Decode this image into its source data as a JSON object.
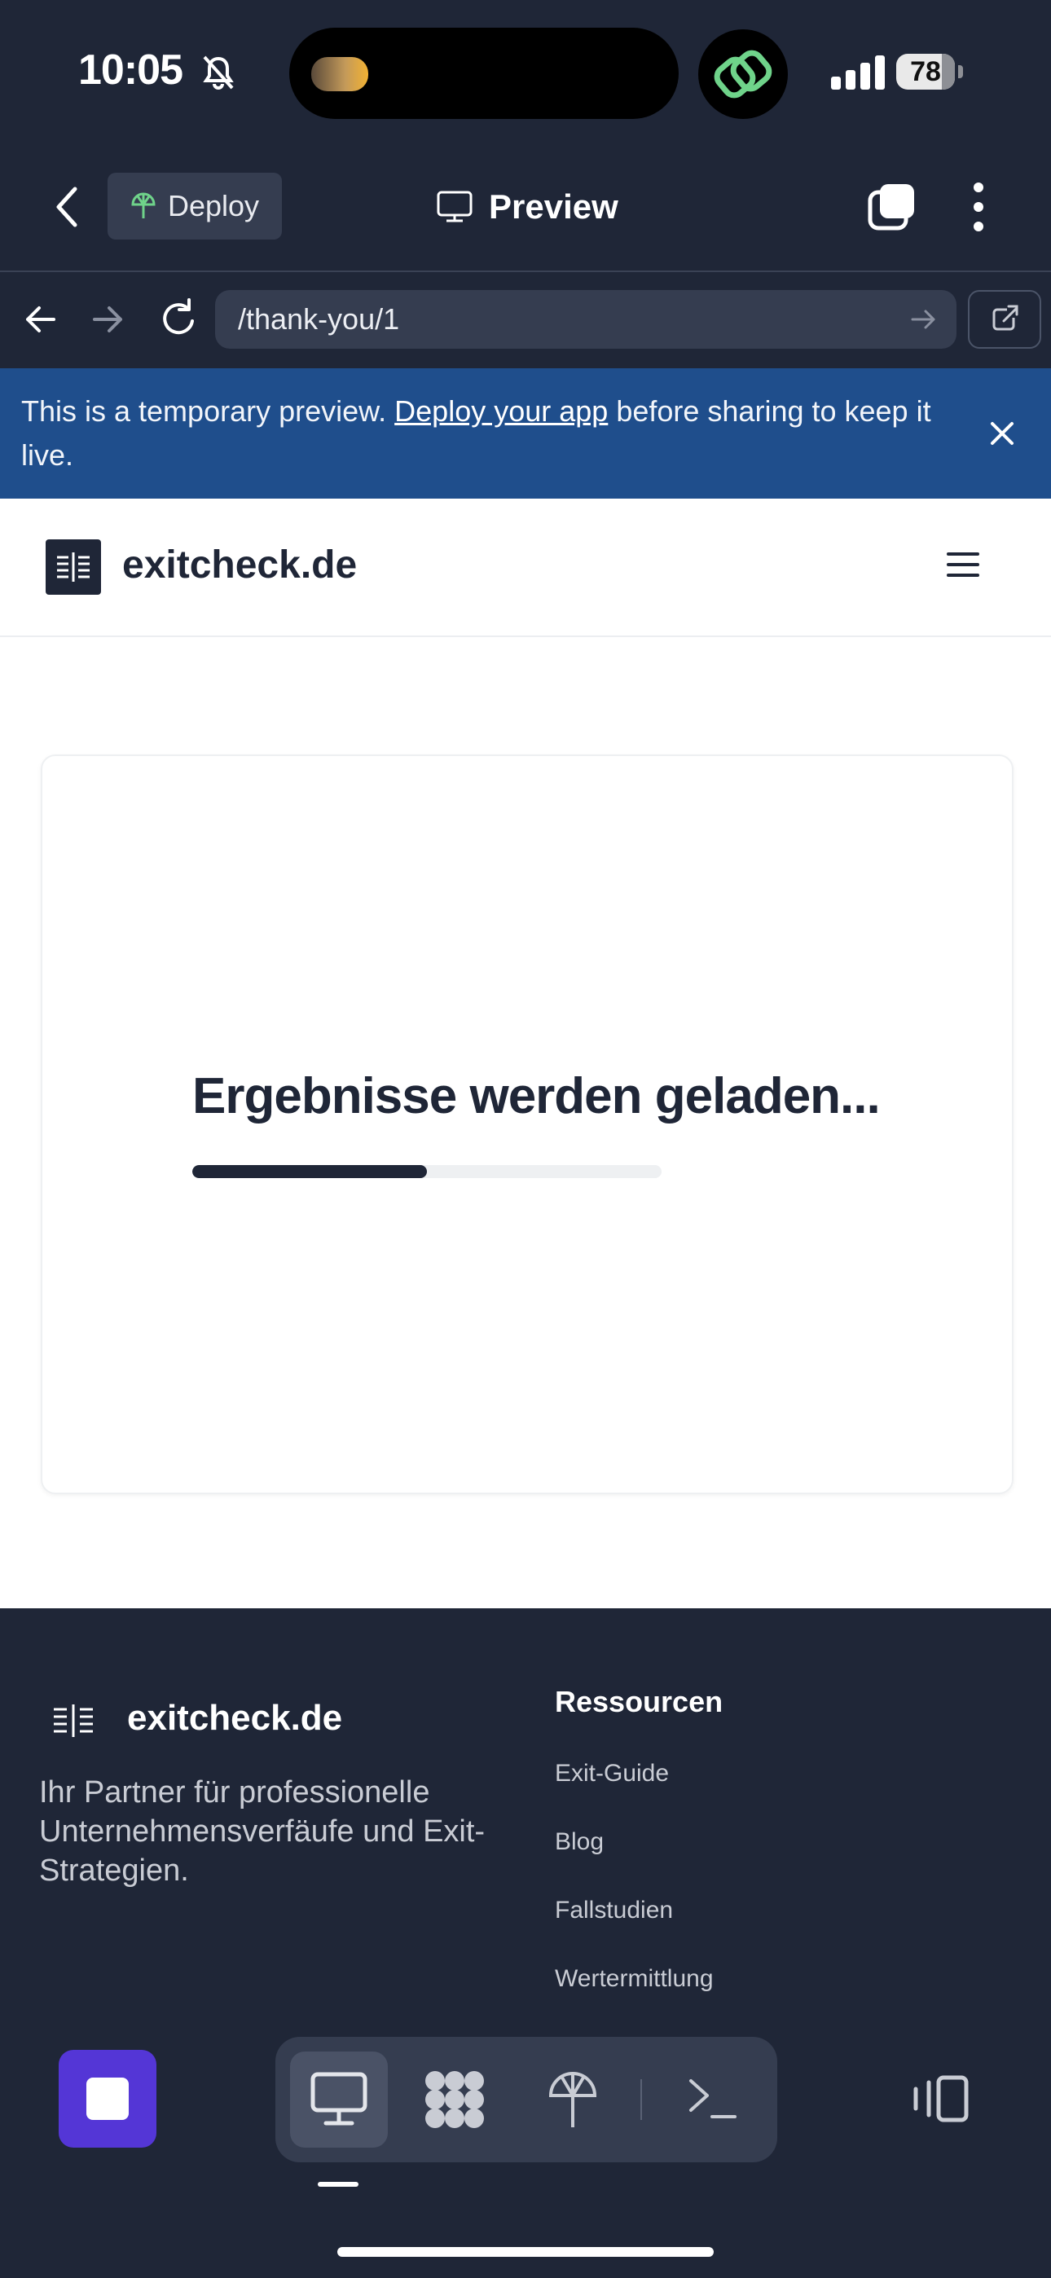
{
  "status_bar": {
    "time": "10:05",
    "battery": "78"
  },
  "toolbar": {
    "deploy_label": "Deploy",
    "title": "Preview"
  },
  "browser": {
    "url": "/thank-you/1"
  },
  "banner": {
    "text_before": "This is a temporary preview. ",
    "link": "Deploy your app",
    "text_after": " before sharing to keep it live."
  },
  "site": {
    "name": "exitcheck.de",
    "loading_title": "Ergebnisse werden geladen...",
    "progress_fraction": 0.5
  },
  "footer": {
    "name": "exitcheck.de",
    "description": "Ihr Partner für professionelle Unternehmensverfäufe und Exit-Strategien.",
    "resources_title": "Ressourcen",
    "links": [
      "Exit-Guide",
      "Blog",
      "Fallstudien",
      "Wertermittlung"
    ]
  },
  "colors": {
    "app_bg": "#1f2637",
    "banner_bg": "#1f4e8c",
    "stop_button": "#5436d6",
    "deploy_icon": "#6fd38a"
  }
}
